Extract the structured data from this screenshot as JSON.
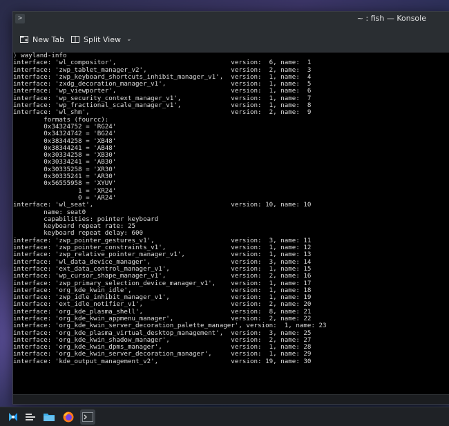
{
  "window": {
    "title": "~ : fish — Konsole"
  },
  "toolbar": {
    "new_tab_label": "New Tab",
    "split_view_label": "Split View"
  },
  "terminal": {
    "prompt_glyph": "⟩",
    "command": "wayland-info",
    "lines": [
      "interface: 'wl_compositor',                              version:  6, name:  1",
      "interface: 'zwp_tablet_manager_v2',                      version:  2, name:  3",
      "interface: 'zwp_keyboard_shortcuts_inhibit_manager_v1',  version:  1, name:  4",
      "interface: 'zxdg_decoration_manager_v1',                 version:  1, name:  5",
      "interface: 'wp_viewporter',                              version:  1, name:  6",
      "interface: 'wp_security_context_manager_v1',             version:  1, name:  7",
      "interface: 'wp_fractional_scale_manager_v1',             version:  1, name:  8",
      "interface: 'wl_shm',                                     version:  2, name:  9",
      "        formats (fourcc):",
      "        0x34324752 = 'RG24'",
      "        0x34324742 = 'BG24'",
      "        0x38344258 = 'XB48'",
      "        0x38344241 = 'AB48'",
      "        0x30334258 = 'XB30'",
      "        0x30334241 = 'AB30'",
      "        0x30335258 = 'XR30'",
      "        0x30335241 = 'AR30'",
      "        0x56555958 = 'XYUV'",
      "                 1 = 'XR24'",
      "                 0 = 'AR24'",
      "interface: 'wl_seat',                                    version: 10, name: 10",
      "        name: seat0",
      "        capabilities: pointer keyboard",
      "        keyboard repeat rate: 25",
      "        keyboard repeat delay: 600",
      "interface: 'zwp_pointer_gestures_v1',                    version:  3, name: 11",
      "interface: 'zwp_pointer_constraints_v1',                 version:  1, name: 12",
      "interface: 'zwp_relative_pointer_manager_v1',            version:  1, name: 13",
      "interface: 'wl_data_device_manager',                     version:  3, name: 14",
      "interface: 'ext_data_control_manager_v1',                version:  1, name: 15",
      "interface: 'wp_cursor_shape_manager_v1',                 version:  2, name: 16",
      "interface: 'zwp_primary_selection_device_manager_v1',    version:  1, name: 17",
      "interface: 'org_kde_kwin_idle',                          version:  1, name: 18",
      "interface: 'zwp_idle_inhibit_manager_v1',                version:  1, name: 19",
      "interface: 'ext_idle_notifier_v1',                       version:  2, name: 20",
      "interface: 'org_kde_plasma_shell',                       version:  8, name: 21",
      "interface: 'org_kde_kwin_appmenu_manager',               version:  2, name: 22",
      "interface: 'org_kde_kwin_server_decoration_palette_manager', version:  1, name: 23",
      "interface: 'org_kde_plasma_virtual_desktop_management',  version:  3, name: 25",
      "interface: 'org_kde_kwin_shadow_manager',                version:  2, name: 27",
      "interface: 'org_kde_kwin_dpms_manager',                  version:  1, name: 28",
      "interface: 'org_kde_kwin_server_decoration_manager',     version:  1, name: 29",
      "interface: 'kde_output_management_v2',                   version: 19, name: 30"
    ]
  },
  "taskbar": {
    "items": [
      {
        "icon": "application-launcher-icon",
        "active": false
      },
      {
        "icon": "task-manager-icon",
        "active": false
      },
      {
        "icon": "file-manager-icon",
        "active": false
      },
      {
        "icon": "firefox-icon",
        "active": false
      },
      {
        "icon": "konsole-icon",
        "active": true
      }
    ]
  },
  "colors": {
    "terminal_bg": "#000000",
    "terminal_fg": "#dcdcdc",
    "chrome_bg": "#2a2e32",
    "taskbar_bg": "#1f2226",
    "active_task": "#3a3f45"
  }
}
